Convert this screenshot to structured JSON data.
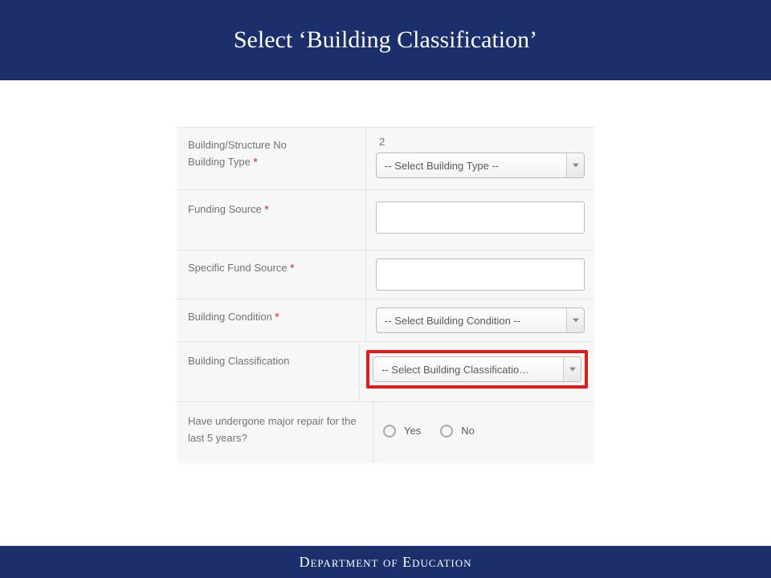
{
  "header": {
    "title": "Select ‘Building Classification’"
  },
  "form": {
    "building_structure_no": {
      "label": "Building/Structure No",
      "value": "2"
    },
    "building_type": {
      "label": "Building Type",
      "required": true,
      "placeholder": "-- Select Building Type --"
    },
    "funding_source": {
      "label": "Funding Source",
      "required": true,
      "value": ""
    },
    "specific_fund_source": {
      "label": "Specific Fund Source",
      "required": true,
      "value": ""
    },
    "building_condition": {
      "label": "Building Condition",
      "required": true,
      "placeholder": "-- Select Building Condition --"
    },
    "building_classification": {
      "label": "Building Classification",
      "required": false,
      "placeholder": "-- Select Building Classificatio…",
      "highlighted": true
    },
    "major_repair": {
      "label": "Have undergone major repair for the last 5 years?",
      "options": {
        "yes": "Yes",
        "no": "No"
      }
    },
    "required_marker": "*"
  },
  "footer": {
    "text": "Department of Education"
  }
}
